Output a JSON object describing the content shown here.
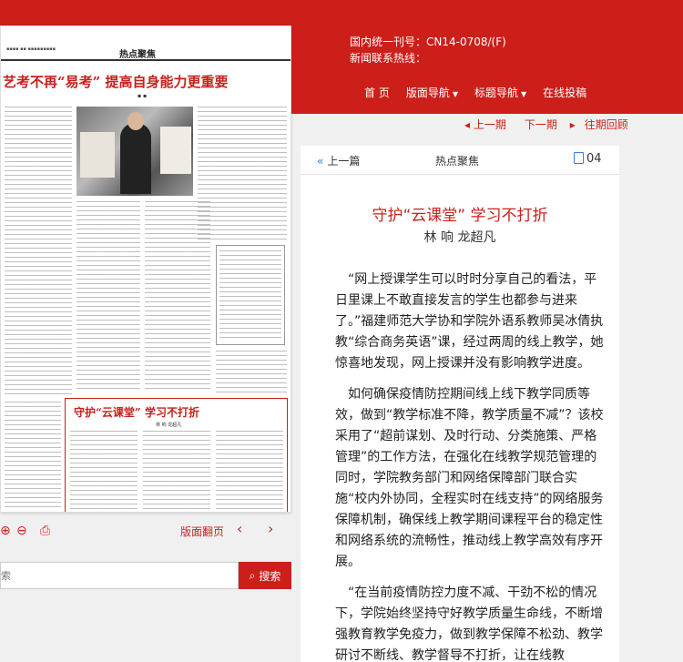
{
  "header": {
    "issn_line": "国内统一刊号：CN14-0708/(F)",
    "hotline": "新闻联系热线：",
    "nav": [
      {
        "label": "首 页",
        "dropdown": false
      },
      {
        "label": "版面导航",
        "dropdown": true
      },
      {
        "label": "标题导航",
        "dropdown": true
      },
      {
        "label": "在线投稿",
        "dropdown": false
      }
    ]
  },
  "issue_nav": {
    "prev_issue": "上一期",
    "next_issue": "下一期",
    "archive": "往期回顾"
  },
  "newspaper": {
    "section": "热点聚焦",
    "headline": "艺考不再“易考” 提高自身能力更重要",
    "inner_title": "守护“云课堂” 学习不打折",
    "inner_author": "林 响 龙超凡"
  },
  "toolbar": {
    "flip_label": "版面翻页"
  },
  "search": {
    "placeholder": "索",
    "button": "搜索"
  },
  "article": {
    "prev": "上一篇",
    "section": "热点聚焦",
    "page": "04",
    "title": "守护“云课堂” 学习不打折",
    "author": "林 响 龙超凡",
    "paragraphs": [
      "“网上授课学生可以时时分享自己的看法，平日里课上不敢直接发言的学生也都参与进来了。”福建师范大学协和学院外语系教师吴冰倩执教“综合商务英语”课，经过两周的线上教学，她惊喜地发现，网上授课并没有影响教学进度。",
      "如何确保疫情防控期间线上线下教学同质等效，做到“教学标准不降，教学质量不减”？该校采用了“超前谋划、及时行动、分类施策、严格管理”的工作方法，在强化在线教学规范管理的同时，学院教务部门和网络保障部门联合实施“校内外协同，全程实时在线支持”的网络服务保障机制，确保线上教学期间课程平台的稳定性和网络系统的流畅性，推动线上教学高效有序开展。",
      "“在当前疫情防控力度不减、干劲不松的情况下，学院始终坚持守好教学质量生命线，不断增强教育教学免疫力，做到教学保障不松劲、教学研讨不断线、教学督导不打折，让在线教"
    ]
  }
}
